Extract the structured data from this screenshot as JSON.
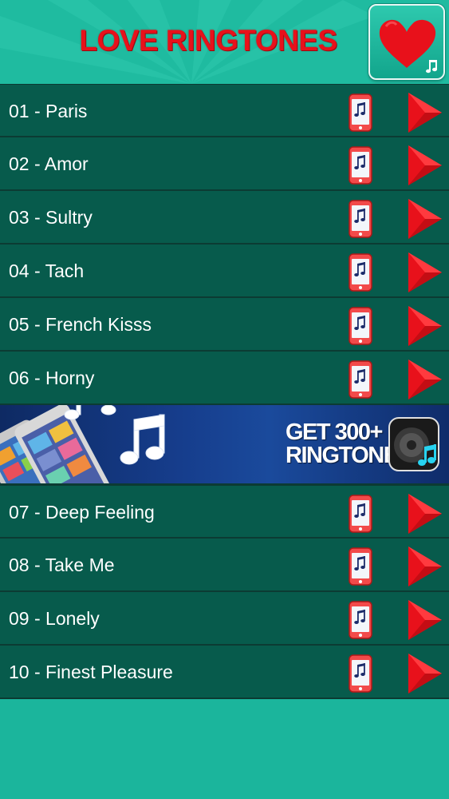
{
  "header": {
    "title": "LOVE RINGTONES",
    "favorite_icon": "heart-music-icon",
    "title_color": "#e8111b"
  },
  "list": {
    "row_icons": {
      "ringtone": "phone-music-icon",
      "play": "play-triangle-icon"
    },
    "items_before_banner": [
      {
        "label": "01 - Paris"
      },
      {
        "label": "02 - Amor"
      },
      {
        "label": "03 - Sultry"
      },
      {
        "label": "04 - Tach"
      },
      {
        "label": "05 - French Kisss"
      },
      {
        "label": "06 - Horny"
      }
    ],
    "items_after_banner": [
      {
        "label": "07 - Deep Feeling"
      },
      {
        "label": "08 - Take Me"
      },
      {
        "label": "09 - Lonely"
      },
      {
        "label": "10 - Finest Pleasure"
      }
    ]
  },
  "banner": {
    "line1": "GET 300+",
    "line2": "RINGTONES",
    "icon": "speaker-music-icon"
  },
  "colors": {
    "background": "#1bb59c",
    "row": "#075b4c",
    "play": "#e8111b"
  }
}
